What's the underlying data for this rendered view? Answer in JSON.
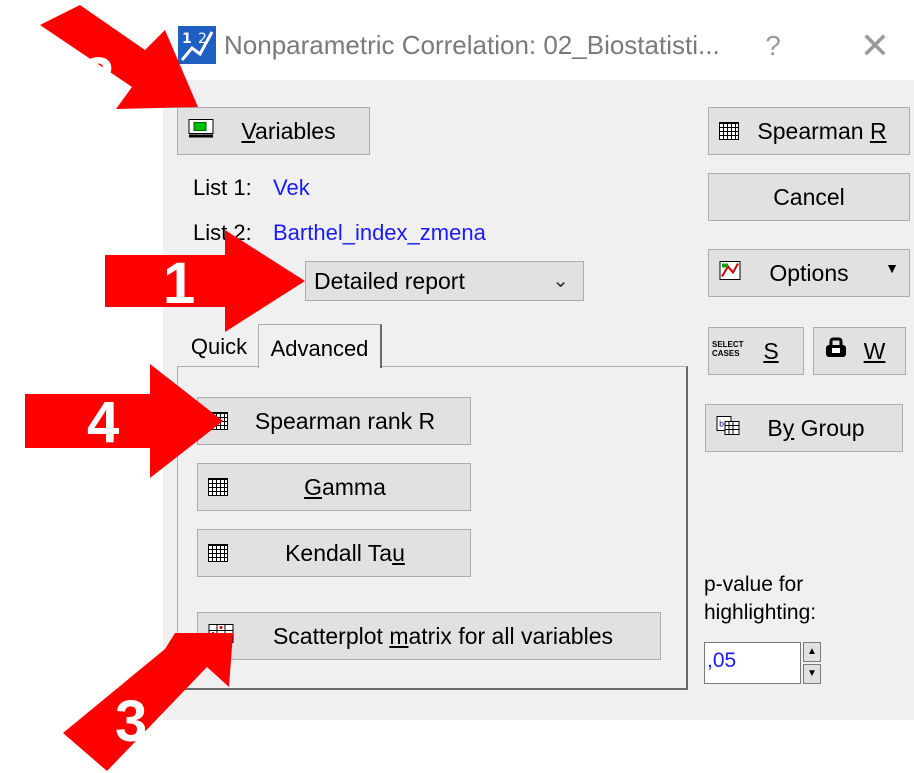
{
  "window": {
    "title": "Nonparametric Correlation: 02_Biostatisti...",
    "help": "?",
    "close": "✕"
  },
  "variables_button": {
    "label_first": "V",
    "label_rest": "ariables"
  },
  "list1": {
    "label": "List 1:",
    "value": "Vek"
  },
  "list2": {
    "label": "List 2:",
    "value": "Barthel_index_zmena"
  },
  "report_select": {
    "value": "Detailed report"
  },
  "tabs": {
    "quick": "Quick",
    "advanced": "Advanced"
  },
  "advanced_buttons": {
    "spearman_rank": "Spearman rank R",
    "gamma_first": "G",
    "gamma_rest": "amma",
    "kendall_pre": "Kendall Ta",
    "kendall_u": "u",
    "scatter_pre": "Scatterplot ",
    "scatter_u": "m",
    "scatter_rest": "atrix for all variables"
  },
  "right_buttons": {
    "spearman_pre": "Spearman ",
    "spearman_u": "R",
    "cancel": "Cancel",
    "options": "Options",
    "select_cases_text": "SELECT CASES",
    "s_label": "S",
    "w_label": "W",
    "bygroup_pre": "B",
    "bygroup_u": "y",
    "bygroup_rest": " Group"
  },
  "pvalue": {
    "label_line1": "p-value for",
    "label_line2": "highlighting:",
    "value": ",05"
  },
  "annotations": {
    "a1": "1",
    "a2": "2",
    "a3": "3",
    "a4": "4"
  },
  "colors": {
    "arrow": "#ff0000",
    "list_value": "#1a1aff",
    "button_face": "#e1e1e1"
  }
}
